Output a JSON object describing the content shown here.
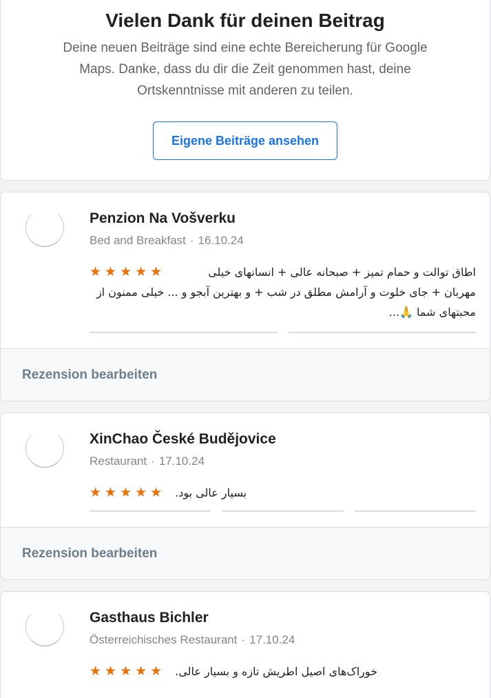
{
  "thanks": {
    "title": "Vielen Dank für deinen Beitrag",
    "message": "Deine neuen Beiträge sind eine echte Bereicherung für Google Maps. Danke, dass du dir die Zeit genommen hast, deine Ortskenntnisse mit anderen zu teilen.",
    "button_label": "Eigene Beiträge ansehen"
  },
  "reviews": [
    {
      "place": "Penzion Na Vošverku",
      "category": "Bed and Breakfast",
      "date": "16.10.24",
      "stars": "★★★★★",
      "rating": 5,
      "text": "اطاق توالت و حمام تمیز + صبحانه عالی + انسانهای خیلی مهربان + جای خلوت و آرامش مطلق در شب + و بهترین آبجو و ... خیلی ممنون از محبتهای شما 🙏...",
      "edit_label": "Rezension bearbeiten"
    },
    {
      "place": "XinChao České Budějovice",
      "category": "Restaurant",
      "date": "17.10.24",
      "stars": "★★★★★",
      "rating": 5,
      "text": "بسیار عالی بود.",
      "edit_label": "Rezension bearbeiten"
    },
    {
      "place": "Gasthaus Bichler",
      "category": "Österreichisches Restaurant",
      "date": "17.10.24",
      "stars": "★★★★★",
      "rating": 5,
      "text": "خوراک‌های اصیل اطریش تازه و بسیار عالی."
    }
  ],
  "colors": {
    "accent": "#1a73e8",
    "star": "#e8710a",
    "edit": "#6c7d8c"
  }
}
